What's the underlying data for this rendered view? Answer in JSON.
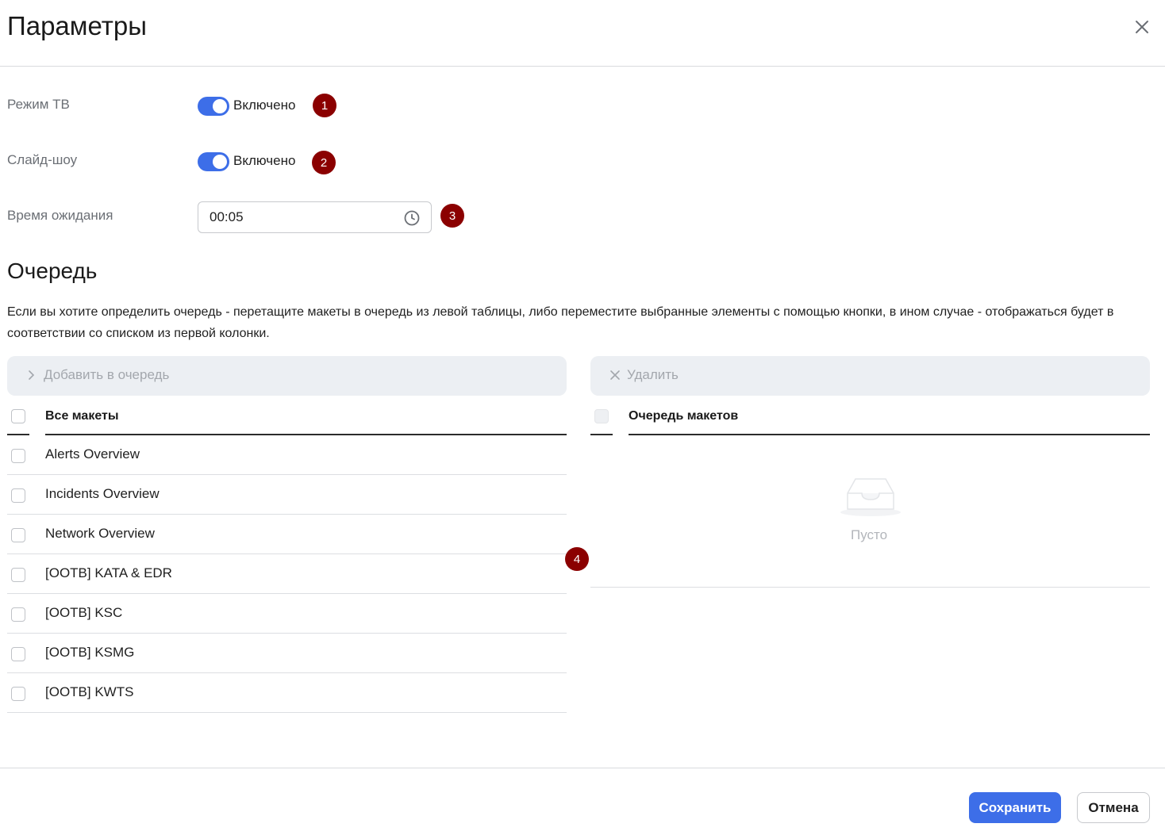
{
  "dialog": {
    "title": "Параметры",
    "close_icon": "close-icon"
  },
  "settings": {
    "tv_mode": {
      "label": "Режим ТВ",
      "state_label": "Включено",
      "enabled": true,
      "marker": "1"
    },
    "slideshow": {
      "label": "Слайд-шоу",
      "state_label": "Включено",
      "enabled": true,
      "marker": "2"
    },
    "wait_time": {
      "label": "Время ожидания",
      "value": "00:05",
      "icon": "clock-icon",
      "marker": "3"
    }
  },
  "queue": {
    "title": "Очередь",
    "description": "Если вы хотите определить очередь - перетащите макеты в очередь из левой таблицы, либо переместите выбранные элементы с помощью кнопки, в ином случае - отображаться будет в соответствии со списком из первой колонки.",
    "add_button": "Добавить в очередь",
    "delete_button": "Удалить",
    "left_header": "Все макеты",
    "right_header": "Очередь макетов",
    "marker": "4",
    "layouts": [
      "Alerts Overview",
      "Incidents Overview",
      "Network Overview",
      "[OOTB] KATA & EDR",
      "[OOTB] KSC",
      "[OOTB] KSMG",
      "[OOTB] KWTS"
    ],
    "empty_text": "Пусто"
  },
  "footer": {
    "save_label": "Сохранить",
    "cancel_label": "Отмена"
  },
  "colors": {
    "accent": "#3d6ee8",
    "marker": "#8b0000",
    "action_bar": "#eceff3"
  }
}
